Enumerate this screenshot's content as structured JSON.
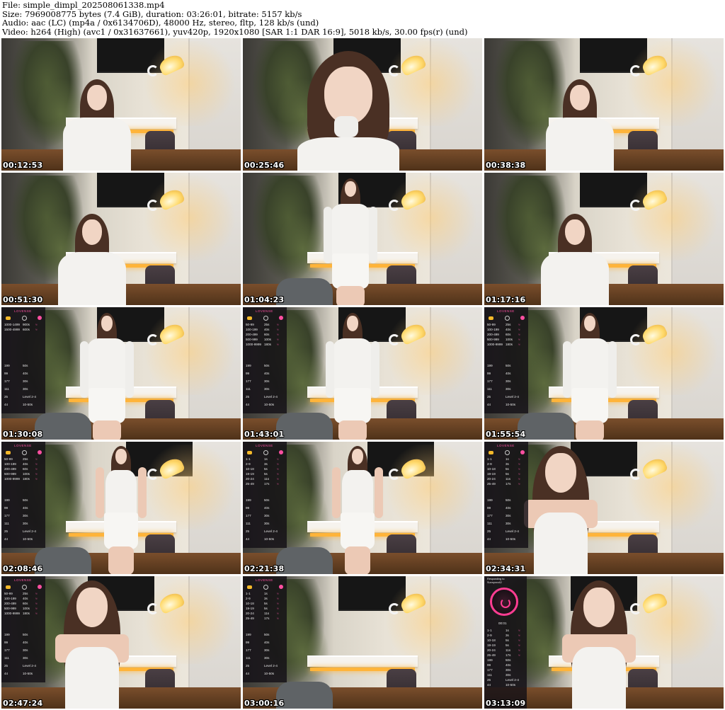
{
  "header": {
    "file_line": "File: simple_dimpl_202508061338.mp4",
    "size_line": "Size: 7969008775 bytes (7.4 GiB), duration: 03:26:01, bitrate: 5157 kb/s",
    "audio_line": "Audio: aac (LC) (mp4a / 0x6134706D), 48000 Hz, stereo, fltp, 128 kb/s (und)",
    "video_line": "Video: h264 (High) (avc1 / 0x31637661), yuv420p, 1920x1080 [SAR 1:1 DAR 16:9], 5018 kb/s, 30.00 fps(r) (und)"
  },
  "overlay": {
    "brand": "LOVENSE",
    "responding_label": "Responding to",
    "responding_user": "Sunnyxxx42",
    "dial_readout": "00:01",
    "menu_a": [
      {
        "tokens": "1000-1499",
        "time": "900s"
      },
      {
        "tokens": "1500-4999",
        "time": "600s"
      }
    ],
    "menu_b": [
      {
        "tokens": "50-99",
        "time": "25s"
      },
      {
        "tokens": "100-199",
        "time": "40s"
      },
      {
        "tokens": "200-499",
        "time": "60s"
      },
      {
        "tokens": "500-999",
        "time": "100s"
      },
      {
        "tokens": "1000-9999",
        "time": "180s"
      }
    ],
    "menu_c": [
      {
        "tokens": "1-1",
        "time": "1s"
      },
      {
        "tokens": "2-9",
        "time": "3s"
      },
      {
        "tokens": "10-18",
        "time": "5s"
      },
      {
        "tokens": "19-19",
        "time": "5s"
      },
      {
        "tokens": "20-24",
        "time": "11s"
      },
      {
        "tokens": "25-49",
        "time": "17s"
      }
    ],
    "specials": [
      {
        "tokens": "199",
        "time": "50s"
      },
      {
        "tokens": "99",
        "time": "40s"
      },
      {
        "tokens": "177",
        "time": "30s"
      },
      {
        "tokens": "111",
        "time": "30s"
      },
      {
        "tokens": "25",
        "time": "Level 2-4"
      },
      {
        "tokens": "44",
        "time": "10-50s"
      }
    ]
  },
  "thumbnails": [
    {
      "timestamp": "00:12:53"
    },
    {
      "timestamp": "00:25:46"
    },
    {
      "timestamp": "00:38:38"
    },
    {
      "timestamp": "00:51:30"
    },
    {
      "timestamp": "01:04:23"
    },
    {
      "timestamp": "01:17:16"
    },
    {
      "timestamp": "01:30:08"
    },
    {
      "timestamp": "01:43:01"
    },
    {
      "timestamp": "01:55:54"
    },
    {
      "timestamp": "02:08:46"
    },
    {
      "timestamp": "02:21:38"
    },
    {
      "timestamp": "02:34:31"
    },
    {
      "timestamp": "02:47:24"
    },
    {
      "timestamp": "03:00:16"
    },
    {
      "timestamp": "03:13:09"
    }
  ],
  "colors": {
    "background": "#ffffff",
    "timestamp_text": "#ffffff",
    "overlay_accent": "#ff4fa1",
    "lamp": "#ffd96a"
  }
}
